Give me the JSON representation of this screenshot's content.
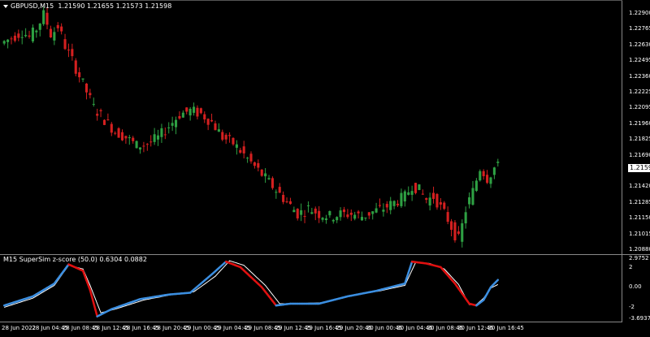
{
  "main_chart": {
    "symbol_timeframe": "GBPUSD,M15",
    "ohlc_values": "1.21590 1.21655 1.21573 1.21598",
    "price_axis_ticks": [
      "1.22900",
      "1.22765",
      "1.22630",
      "1.22495",
      "1.22360",
      "1.22225",
      "1.22095",
      "1.21960",
      "1.21825",
      "1.21690",
      "1.21555",
      "1.21420",
      "1.21285",
      "1.21150",
      "1.21015",
      "1.20880"
    ],
    "current_price": "1.21598",
    "candle_colors": {
      "bull": "#2ea043",
      "bear": "#d42020"
    }
  },
  "indicator": {
    "title": "M15 SuperSim z-score (50.0) 0.6304 0.0882",
    "axis_ticks": [
      "2.9752",
      "2",
      "0.00",
      "-2",
      "-3.6937"
    ],
    "line_colors": {
      "fast": "#3b8ee0",
      "fast_down": "#e01010",
      "slow": "#ffffff"
    }
  },
  "time_axis": {
    "labels": [
      "28 Jun 2022",
      "28 Jun 04:45",
      "28 Jun 08:45",
      "28 Jun 12:45",
      "28 Jun 16:45",
      "28 Jun 20:45",
      "29 Jun 00:45",
      "29 Jun 04:45",
      "29 Jun 08:45",
      "29 Jun 12:45",
      "29 Jun 16:45",
      "29 Jun 20:45",
      "30 Jun 00:45",
      "30 Jun 04:45",
      "30 Jun 08:45",
      "30 Jun 12:45",
      "30 Jun 16:45"
    ]
  },
  "chart_data": [
    {
      "type": "candlestick",
      "title": "GBPUSD,M15",
      "ylim": [
        1.2088,
        1.2295
      ],
      "path_anchors": [
        [
          0,
          1.2265
        ],
        [
          3,
          1.227
        ],
        [
          6,
          1.2275
        ],
        [
          8,
          1.227
        ],
        [
          10,
          1.2278
        ],
        [
          12,
          1.229
        ],
        [
          14,
          1.2272
        ],
        [
          16,
          1.228
        ],
        [
          18,
          1.2262
        ],
        [
          20,
          1.225
        ],
        [
          23,
          1.223
        ],
        [
          26,
          1.221
        ],
        [
          29,
          1.22
        ],
        [
          32,
          1.219
        ],
        [
          35,
          1.2185
        ],
        [
          38,
          1.2178
        ],
        [
          41,
          1.218
        ],
        [
          44,
          1.2185
        ],
        [
          47,
          1.2195
        ],
        [
          50,
          1.2205
        ],
        [
          53,
          1.2208
        ],
        [
          56,
          1.2205
        ],
        [
          59,
          1.2198
        ],
        [
          62,
          1.2185
        ],
        [
          65,
          1.218
        ],
        [
          68,
          1.217
        ],
        [
          71,
          1.216
        ],
        [
          74,
          1.215
        ],
        [
          77,
          1.214
        ],
        [
          80,
          1.213
        ],
        [
          83,
          1.212
        ],
        [
          86,
          1.2125
        ],
        [
          89,
          1.212
        ],
        [
          92,
          1.2118
        ],
        [
          95,
          1.212
        ],
        [
          98,
          1.212
        ],
        [
          101,
          1.2118
        ],
        [
          104,
          1.2122
        ],
        [
          107,
          1.2125
        ],
        [
          110,
          1.213
        ],
        [
          113,
          1.2135
        ],
        [
          115,
          1.2145
        ],
        [
          117,
          1.214
        ],
        [
          119,
          1.2132
        ],
        [
          121,
          1.2135
        ],
        [
          123,
          1.2125
        ],
        [
          125,
          1.2115
        ],
        [
          127,
          1.2102
        ],
        [
          128,
          1.2098
        ],
        [
          130,
          1.2125
        ],
        [
          132,
          1.214
        ],
        [
          134,
          1.216
        ],
        [
          136,
          1.215
        ],
        [
          138,
          1.216
        ]
      ]
    },
    {
      "type": "line",
      "title": "M15 SuperSim z-score (50.0) 0.6304 0.0882",
      "ylim": [
        -3.6937,
        2.9752
      ],
      "series": [
        {
          "values": [
            [
              0,
              -2.2
            ],
            [
              8,
              -1.2
            ],
            [
              14,
              0.2
            ],
            [
              18,
              2.3
            ],
            [
              22,
              1.6
            ],
            [
              24,
              -0.5
            ],
            [
              26,
              -3.4
            ],
            [
              30,
              -2.6
            ],
            [
              38,
              -1.5
            ],
            [
              46,
              -1.0
            ],
            [
              52,
              -0.8
            ],
            [
              58,
              1.2
            ],
            [
              62,
              2.6
            ],
            [
              66,
              2.0
            ],
            [
              72,
              -0.2
            ],
            [
              76,
              -2.2
            ],
            [
              80,
              -2.0
            ],
            [
              88,
              -2.0
            ],
            [
              96,
              -1.2
            ],
            [
              104,
              -0.6
            ],
            [
              112,
              0.2
            ],
            [
              114,
              2.6
            ],
            [
              118,
              2.4
            ],
            [
              122,
              2.0
            ],
            [
              126,
              0.2
            ],
            [
              130,
              -2.0
            ],
            [
              132,
              -2.2
            ],
            [
              134,
              -1.6
            ],
            [
              136,
              -0.2
            ],
            [
              138,
              0.6
            ]
          ]
        },
        {
          "values": [
            [
              0,
              -2.4
            ],
            [
              8,
              -1.4
            ],
            [
              14,
              0.0
            ],
            [
              18,
              2.2
            ],
            [
              22,
              1.8
            ],
            [
              24,
              0.0
            ],
            [
              27,
              -3.0
            ],
            [
              31,
              -2.6
            ],
            [
              39,
              -1.6
            ],
            [
              47,
              -1.0
            ],
            [
              53,
              -0.7
            ],
            [
              59,
              1.0
            ],
            [
              63,
              2.7
            ],
            [
              67,
              2.2
            ],
            [
              73,
              0.0
            ],
            [
              77,
              -2.0
            ],
            [
              81,
              -2.0
            ],
            [
              89,
              -1.9
            ],
            [
              97,
              -1.1
            ],
            [
              105,
              -0.6
            ],
            [
              112,
              0.0
            ],
            [
              115,
              2.5
            ],
            [
              119,
              2.4
            ],
            [
              123,
              1.8
            ],
            [
              127,
              0.1
            ],
            [
              130,
              -2.1
            ],
            [
              132,
              -2.1
            ],
            [
              134,
              -1.4
            ],
            [
              136,
              -0.3
            ],
            [
              138,
              0.1
            ]
          ]
        }
      ]
    }
  ]
}
